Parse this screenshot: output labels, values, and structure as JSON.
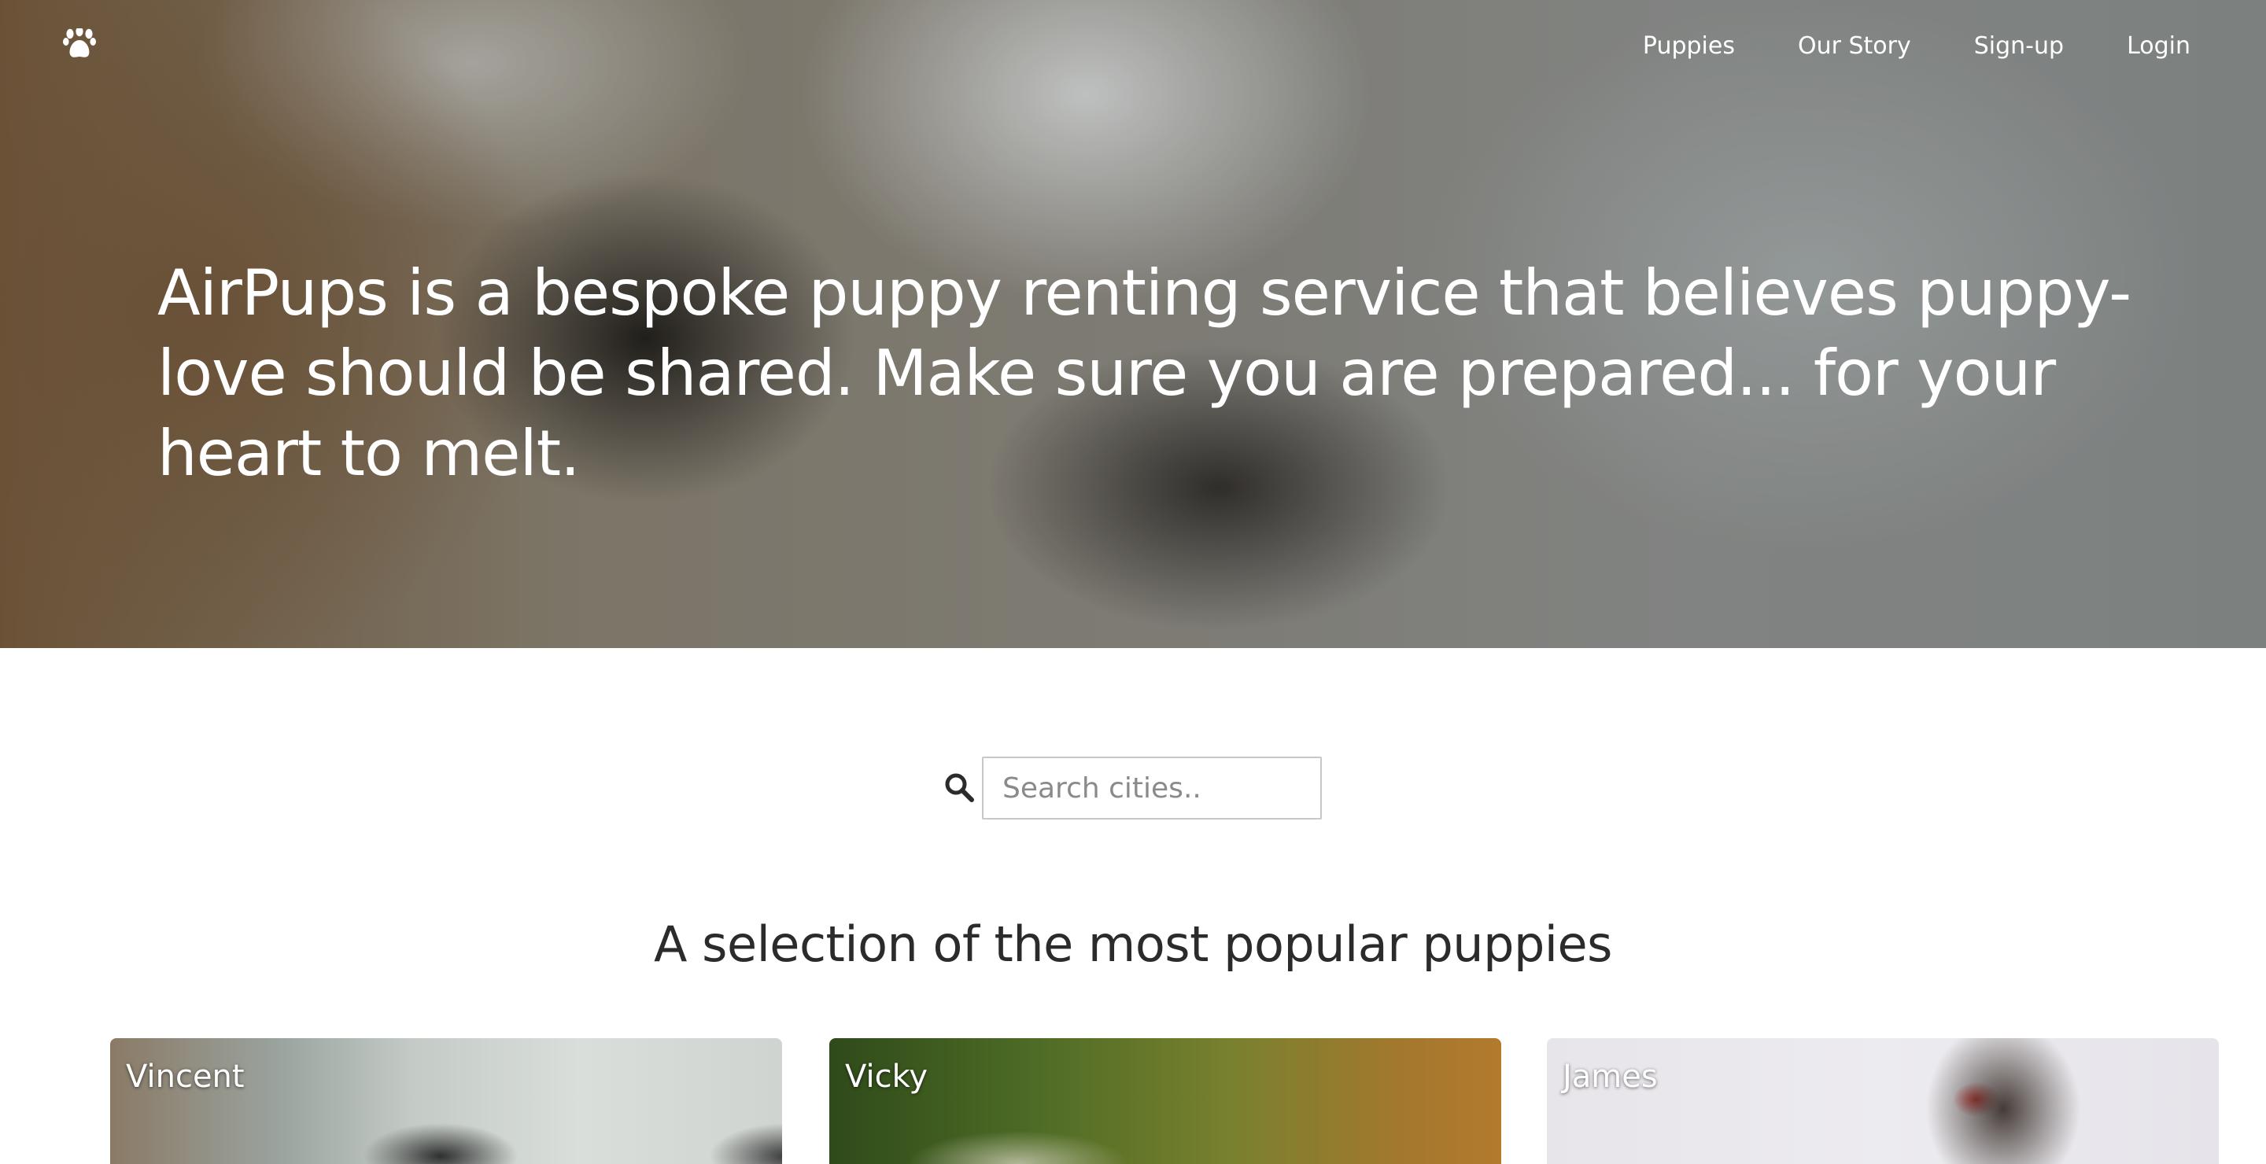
{
  "nav": {
    "items": [
      {
        "label": "Puppies"
      },
      {
        "label": "Our Story"
      },
      {
        "label": "Sign-up"
      },
      {
        "label": "Login"
      }
    ]
  },
  "hero": {
    "text": "AirPups is a bespoke puppy renting service that believes puppy-love should be shared. Make sure you are prepared... for your heart to melt."
  },
  "search": {
    "placeholder": "Search cities..",
    "value": ""
  },
  "section": {
    "title": "A selection of the most popular puppies"
  },
  "cards": [
    {
      "name": "Vincent"
    },
    {
      "name": "Vicky"
    },
    {
      "name": "James"
    }
  ],
  "icons": {
    "logo": "paw-icon",
    "search": "search-icon"
  },
  "colors": {
    "text_light": "#ffffff",
    "title_text": "#2b2b2b",
    "input_border": "#c8c8c8"
  }
}
